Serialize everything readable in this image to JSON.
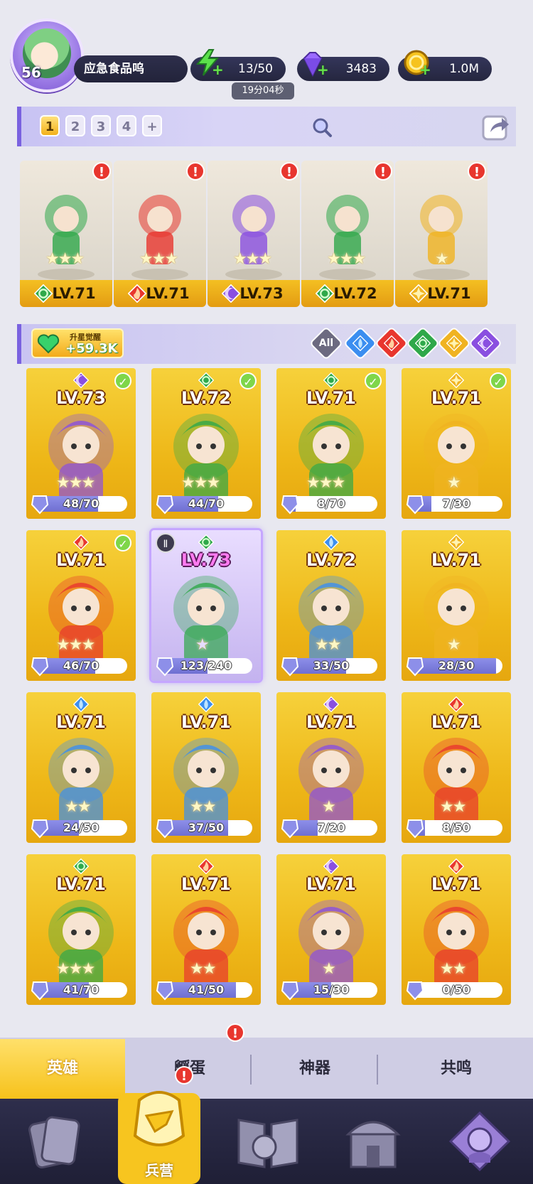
{
  "profile": {
    "level": "56",
    "name": "应急食品呜"
  },
  "resources": {
    "energy": {
      "icon": "lightning-icon",
      "value": "13/50",
      "timer": "19分04秒"
    },
    "gems": {
      "icon": "diamond-icon",
      "value": "3483"
    },
    "gold": {
      "icon": "coin-icon",
      "value": "1.0M"
    }
  },
  "team": {
    "tabs": [
      "1",
      "2",
      "3",
      "4",
      "+"
    ],
    "active_tab": 0,
    "members": [
      {
        "level": "LV.71",
        "element": "nature",
        "stars": 3,
        "alert": "!"
      },
      {
        "level": "LV.71",
        "element": "fire",
        "stars": 3,
        "alert": "!"
      },
      {
        "level": "LV.73",
        "element": "shadow",
        "stars": 3,
        "alert": "!"
      },
      {
        "level": "LV.72",
        "element": "nature",
        "stars": 3,
        "alert": "!"
      },
      {
        "level": "LV.71",
        "element": "light",
        "stars": 1,
        "alert": "!"
      }
    ]
  },
  "awaken": {
    "label": "升星觉醒",
    "value": "+59.3K"
  },
  "filters": [
    "All",
    "water",
    "fire",
    "nature",
    "light",
    "shadow"
  ],
  "filter_all_label": "All",
  "heroes": [
    {
      "level": "LV.73",
      "element": "shadow",
      "progress": "48/70",
      "checked": true,
      "stars": 3
    },
    {
      "level": "LV.72",
      "element": "nature",
      "progress": "44/70",
      "checked": true,
      "stars": 3
    },
    {
      "level": "LV.71",
      "element": "nature",
      "progress": "8/70",
      "checked": true,
      "stars": 3
    },
    {
      "level": "LV.71",
      "element": "light",
      "progress": "7/30",
      "checked": true,
      "stars": 1
    },
    {
      "level": "LV.71",
      "element": "fire",
      "progress": "46/70",
      "checked": true,
      "stars": 3
    },
    {
      "level": "LV.73",
      "element": "nature",
      "progress": "123/240",
      "checked": false,
      "stars": 0,
      "selected": true
    },
    {
      "level": "LV.72",
      "element": "water",
      "progress": "33/50",
      "checked": false,
      "stars": 2
    },
    {
      "level": "LV.71",
      "element": "light",
      "progress": "28/30",
      "checked": false,
      "stars": 1
    },
    {
      "level": "LV.71",
      "element": "water",
      "progress": "24/50",
      "checked": false,
      "stars": 2
    },
    {
      "level": "LV.71",
      "element": "water",
      "progress": "37/50",
      "checked": false,
      "stars": 2
    },
    {
      "level": "LV.71",
      "element": "shadow",
      "progress": "7/20",
      "checked": false,
      "stars": 1
    },
    {
      "level": "LV.71",
      "element": "fire",
      "progress": "8/50",
      "checked": false,
      "stars": 2
    },
    {
      "level": "LV.71",
      "element": "nature",
      "progress": "41/70",
      "checked": false,
      "stars": 3
    },
    {
      "level": "LV.71",
      "element": "fire",
      "progress": "41/50",
      "checked": false,
      "stars": 2
    },
    {
      "level": "LV.71",
      "element": "shadow",
      "progress": "15/30",
      "checked": false,
      "stars": 1
    },
    {
      "level": "LV.71",
      "element": "fire",
      "progress": "0/50",
      "checked": false,
      "stars": 2
    }
  ],
  "subtabs": [
    "英雄",
    "孵蛋",
    "神器",
    "共鸣"
  ],
  "subtab_alert": "!",
  "nav": {
    "barracks_label": "兵营",
    "barracks_alert": "!"
  },
  "colors": {
    "water": "#3b8ef0",
    "fire": "#e8362e",
    "nature": "#2fa84a",
    "light": "#f0b321",
    "shadow": "#8a4fe0",
    "accent": "#f6c21c"
  }
}
